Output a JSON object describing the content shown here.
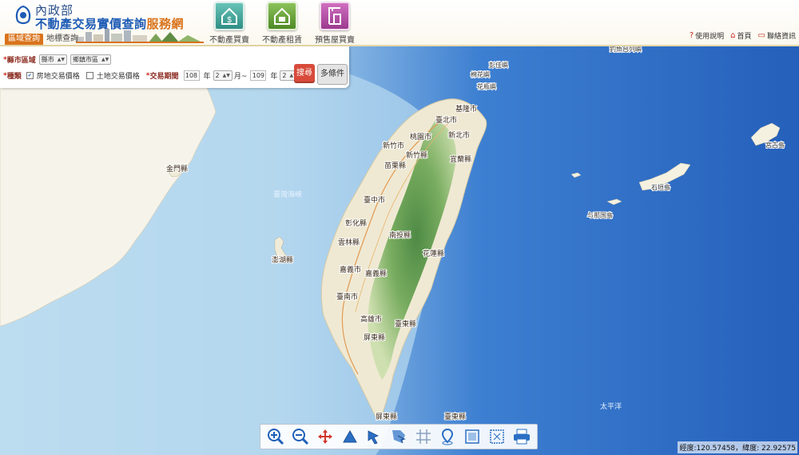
{
  "header": {
    "ministry": "內政部",
    "title_main": "不動產交易實價查詢",
    "title_accent": "服務網",
    "mode_tabs": [
      {
        "label": "區域查詢",
        "active": true
      },
      {
        "label": "地標查詢",
        "active": false
      }
    ],
    "main_nav": [
      {
        "label": "不動產買賣",
        "icon": "house-dollar-icon"
      },
      {
        "label": "不動產租賃",
        "icon": "house-key-icon"
      },
      {
        "label": "預售屋買賣",
        "icon": "crane-building-icon"
      }
    ],
    "util_links": [
      {
        "label": "使用說明",
        "icon": "question-icon"
      },
      {
        "label": "首頁",
        "icon": "home-icon"
      },
      {
        "label": "聯絡資訊",
        "icon": "chat-icon"
      }
    ]
  },
  "query": {
    "region_label": "縣市區域",
    "county_select": "縣市",
    "district_select": "鄉鎮市區",
    "type_label": "種類",
    "type_options": [
      {
        "label": "房地交易價格",
        "checked": true
      },
      {
        "label": "土地交易價格",
        "checked": false
      }
    ],
    "period_label": "交易期間",
    "from_year": "108",
    "year_unit": "年",
    "from_month": "2",
    "month_sep": "月~",
    "to_year": "109",
    "to_month": "2",
    "month_unit": "月",
    "search_button": "搜尋",
    "advanced_button": "多條件"
  },
  "map": {
    "labels": {
      "keelung": "基隆市",
      "taipei": "臺北市",
      "newtaipei": "新北市",
      "taoyuan": "桃園市",
      "hsinchu_city": "新竹市",
      "hsinchu_county": "新竹縣",
      "yilan": "宜蘭縣",
      "miaoli": "苗栗縣",
      "taichung": "臺中市",
      "changhua": "彰化縣",
      "nantou": "南投縣",
      "yunlin": "雲林縣",
      "hualien": "花蓮縣",
      "chiayi_city": "嘉義市",
      "chiayi_county": "嘉義縣",
      "tainan": "臺南市",
      "kaohsiung": "高雄市",
      "taitung": "臺東縣",
      "pingtung": "屏東縣",
      "pingtung_s": "屏東縣",
      "taitung_s": "臺東縣",
      "kinmen": "金門縣",
      "penghu": "澎湖縣",
      "strait": "臺灣海峽",
      "pacific": "太平洋",
      "miyako": "宮古島",
      "ishigaki": "石垣島",
      "yonaguni": "与那国島",
      "senkaku": "釣魚台列嶼",
      "pengjia": "彭佳嶼",
      "mianhua": "棉花嶼",
      "huaping": "花瓶嶼"
    }
  },
  "toolbar": {
    "tools": [
      "zoom-in-icon",
      "zoom-out-icon",
      "pan-icon",
      "measure-area-icon",
      "select-arrow-icon",
      "select-region-icon",
      "grid-icon",
      "location-pin-icon",
      "fullscreen-icon",
      "extent-icon",
      "print-icon"
    ]
  },
  "status": {
    "coords": "經度:120.57458，緯度: 22.92575"
  },
  "colors": {
    "accent_orange": "#d9731c",
    "title_blue": "#1d5bb5",
    "search_red": "#d84a3a",
    "ocean_deep": "#2f66bf",
    "ocean_shallow": "#a9d2ec"
  }
}
